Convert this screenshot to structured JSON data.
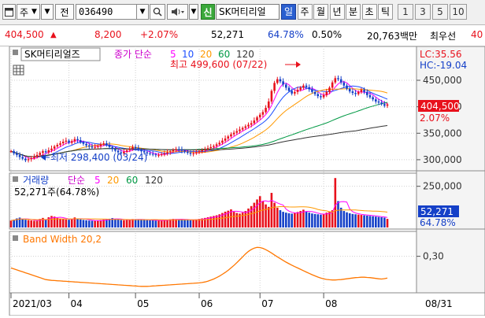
{
  "toolbar": {
    "code_type_label": "주",
    "market_label": "전",
    "stock_code": "036490",
    "badge": "신",
    "stock_name": "SK머티리얼",
    "periods": [
      {
        "label": "일",
        "active": true
      },
      {
        "label": "주",
        "active": false
      },
      {
        "label": "월",
        "active": false
      },
      {
        "label": "년",
        "active": false
      },
      {
        "label": "분",
        "active": false
      },
      {
        "label": "초",
        "active": false
      },
      {
        "label": "틱",
        "active": false
      }
    ],
    "intervals": [
      "1",
      "3",
      "5",
      "10"
    ]
  },
  "quote": {
    "price": "404,500",
    "change": "8,200",
    "change_pct": "+2.07%",
    "volume": "52,271",
    "volume_ratio": "64.78%",
    "turnover": "0.50%",
    "trading_value": "20,763백만",
    "lowest_label": "최우선",
    "extra": "40"
  },
  "colors": {
    "up": "#e8111c",
    "down": "#1540c8",
    "panel_bg": "#ffffff"
  },
  "chart_data": [
    {
      "type": "line",
      "title": "SK머티리얼즈",
      "indicator_label": "종가 단순",
      "ma_periods": [
        "5",
        "10",
        "20",
        "60",
        "120"
      ],
      "ma_colors": [
        "#ff00ff",
        "#1e50ff",
        "#ff9900",
        "#009944",
        "#333333"
      ],
      "annotations": {
        "high": "최고 499,600 (07/22)",
        "low": "최저 298,400 (03/24)"
      },
      "lc_label": "LC:35.56",
      "hc_label": "HC:-19.04",
      "y_ticks": [
        "450,000",
        "400,000",
        "350,000",
        "300,000"
      ],
      "ylim": [
        285000,
        505000
      ],
      "current_price_label": "404,500",
      "current_pct_label": "2.07%",
      "close": [
        316000,
        312000,
        309000,
        305000,
        302000,
        299000,
        301000,
        303000,
        306000,
        309000,
        313000,
        316000,
        314000,
        318000,
        321000,
        325000,
        328000,
        331000,
        334000,
        336000,
        332000,
        335000,
        339000,
        337000,
        333000,
        330000,
        327000,
        325000,
        323000,
        324000,
        326000,
        329000,
        331000,
        328000,
        324000,
        320000,
        317000,
        314000,
        312000,
        315000,
        318000,
        321000,
        324000,
        322000,
        319000,
        316000,
        314000,
        312000,
        311000,
        310000,
        309000,
        309000,
        310000,
        312000,
        314000,
        316000,
        318000,
        320000,
        319000,
        317000,
        315000,
        313000,
        311000,
        312000,
        314000,
        316000,
        318000,
        320000,
        322000,
        324000,
        326000,
        329000,
        332000,
        336000,
        340000,
        344000,
        348000,
        351000,
        354000,
        357000,
        360000,
        363000,
        366000,
        369000,
        374000,
        380000,
        385000,
        390000,
        398000,
        410000,
        430000,
        445000,
        452000,
        448000,
        442000,
        436000,
        430000,
        425000,
        428000,
        432000,
        436000,
        440000,
        437000,
        433000,
        428000,
        424000,
        420000,
        418000,
        422000,
        428000,
        436000,
        446000,
        454000,
        452000,
        446000,
        440000,
        434000,
        429000,
        426000,
        424000,
        428000,
        432000,
        428000,
        422000,
        418000,
        414000,
        410000,
        408000,
        405000,
        402000,
        404500
      ]
    },
    {
      "type": "bar",
      "title": "거래량",
      "indicator_label": "단순",
      "ma_periods": [
        "5",
        "20",
        "60",
        "120"
      ],
      "current_label": "52,271주(64.78%)",
      "y_ticks": [
        "250,000"
      ],
      "ylim": [
        0,
        320000
      ],
      "current_value_label": "52,271",
      "current_pct_label": "64.78%",
      "values": [
        42000,
        48000,
        55000,
        60000,
        51000,
        47000,
        45000,
        43000,
        41000,
        40000,
        52000,
        58000,
        46000,
        62000,
        70000,
        66000,
        58000,
        54000,
        50000,
        48000,
        47000,
        52000,
        61000,
        55000,
        49000,
        46000,
        44000,
        42000,
        41000,
        40000,
        42000,
        45000,
        48000,
        50000,
        53000,
        57000,
        52000,
        48000,
        45000,
        44000,
        46000,
        49000,
        51000,
        50000,
        48000,
        47000,
        46000,
        45000,
        44000,
        43000,
        42000,
        41000,
        43000,
        45000,
        47000,
        50000,
        52000,
        51000,
        49000,
        48000,
        47000,
        46000,
        45000,
        47000,
        49000,
        52000,
        55000,
        58000,
        62000,
        66000,
        70000,
        74000,
        80000,
        88000,
        96000,
        102000,
        110000,
        95000,
        88000,
        84000,
        90000,
        100000,
        115000,
        130000,
        150000,
        170000,
        190000,
        160000,
        140000,
        125000,
        210000,
        150000,
        120000,
        105000,
        95000,
        90000,
        86000,
        84000,
        88000,
        94000,
        100000,
        108000,
        98000,
        90000,
        85000,
        82000,
        80000,
        78000,
        82000,
        90000,
        98000,
        105000,
        300000,
        160000,
        120000,
        100000,
        92000,
        86000,
        82000,
        80000,
        78000,
        76000,
        74000,
        72000,
        70000,
        68000,
        66000,
        64000,
        62000,
        60000,
        52271
      ]
    },
    {
      "type": "line",
      "title": "Band Width 20,2",
      "y_ticks": [
        "0,30"
      ],
      "ylim": [
        0.12,
        0.42
      ],
      "values": [
        0.24,
        0.235,
        0.23,
        0.225,
        0.22,
        0.215,
        0.21,
        0.205,
        0.2,
        0.195,
        0.19,
        0.185,
        0.18,
        0.178,
        0.176,
        0.175,
        0.174,
        0.173,
        0.172,
        0.171,
        0.17,
        0.169,
        0.168,
        0.167,
        0.166,
        0.165,
        0.164,
        0.163,
        0.162,
        0.161,
        0.16,
        0.159,
        0.158,
        0.157,
        0.156,
        0.155,
        0.154,
        0.153,
        0.152,
        0.151,
        0.15,
        0.149,
        0.148,
        0.147,
        0.146,
        0.145,
        0.145,
        0.145,
        0.146,
        0.147,
        0.148,
        0.149,
        0.15,
        0.151,
        0.152,
        0.153,
        0.154,
        0.155,
        0.156,
        0.157,
        0.158,
        0.159,
        0.16,
        0.161,
        0.162,
        0.163,
        0.165,
        0.168,
        0.172,
        0.177,
        0.183,
        0.19,
        0.198,
        0.207,
        0.217,
        0.228,
        0.24,
        0.253,
        0.267,
        0.282,
        0.297,
        0.312,
        0.325,
        0.335,
        0.342,
        0.346,
        0.345,
        0.341,
        0.334,
        0.326,
        0.317,
        0.307,
        0.297,
        0.288,
        0.279,
        0.27,
        0.262,
        0.254,
        0.247,
        0.24,
        0.233,
        0.226,
        0.219,
        0.212,
        0.205,
        0.199,
        0.193,
        0.188,
        0.184,
        0.181,
        0.179,
        0.178,
        0.178,
        0.179,
        0.18,
        0.182,
        0.184,
        0.186,
        0.188,
        0.19,
        0.191,
        0.192,
        0.192,
        0.191,
        0.19,
        0.188,
        0.186,
        0.184,
        0.183,
        0.185,
        0.188
      ]
    }
  ],
  "x_axis": {
    "labels": [
      "2021/03",
      "04",
      "05",
      "06",
      "07",
      "08"
    ],
    "end_label": "08/31"
  }
}
